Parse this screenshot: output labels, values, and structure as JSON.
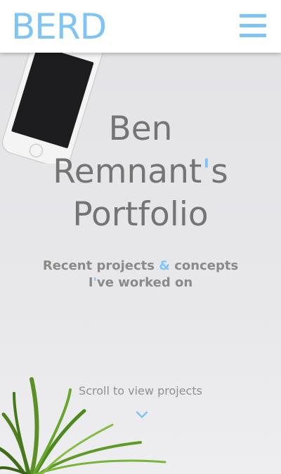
{
  "colors": {
    "accent": "#7fc4f5",
    "text_gray": "#747474",
    "subtitle_gray": "#8a8a8a",
    "hint_gray": "#8f8f8f",
    "header_bg": "#ffffff"
  },
  "header": {
    "logo": "BERD",
    "menu_icon": "hamburger-menu-icon"
  },
  "hero": {
    "title_line1": "Ben",
    "title_line2_a": "Remnant",
    "title_line2_apos": "'",
    "title_line2_b": "s",
    "title_line3": "Portfolio",
    "subtitle_a": "Recent projects ",
    "subtitle_amp": "&",
    "subtitle_b": " concepts I",
    "subtitle_apos": "'",
    "subtitle_c": "ve worked on",
    "scroll_text": "Scroll to view projects",
    "scroll_icon": "chevron-down-icon",
    "decor": [
      "smartphone-image",
      "plant-image"
    ]
  }
}
